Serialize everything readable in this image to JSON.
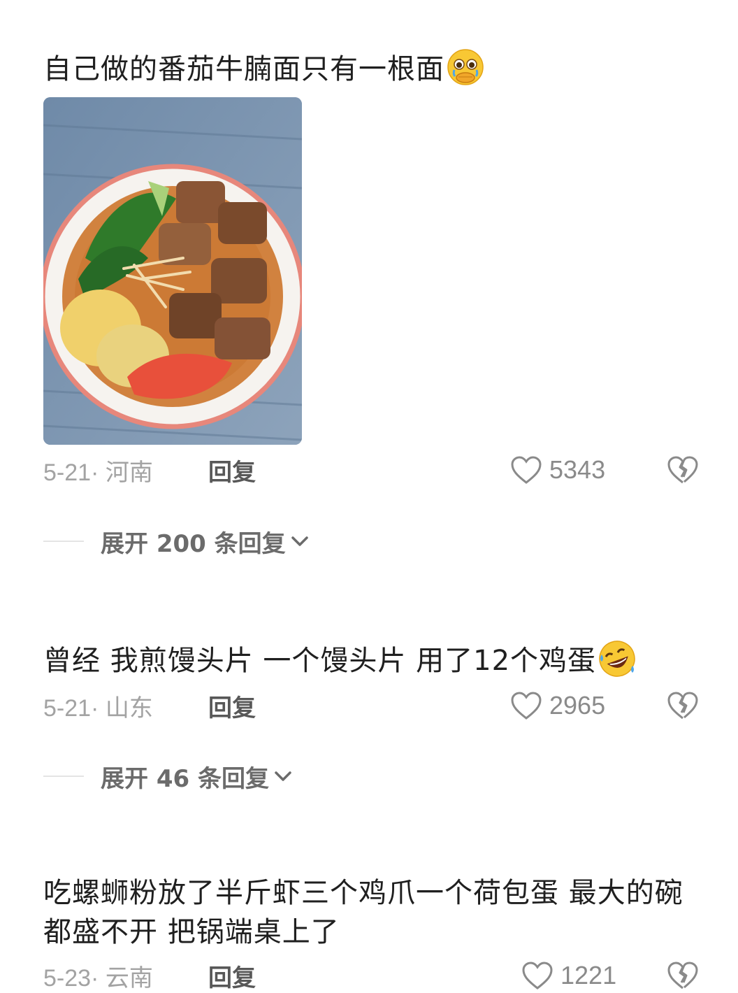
{
  "comments": [
    {
      "text": "自己做的番茄牛腩面只有一根面",
      "emoji": "crying-hands-over-mouth-emoji",
      "date_location": "5-21· 河南",
      "reply_label": "回复",
      "likes": "5343",
      "expand_label": "展开 200 条回复"
    },
    {
      "text": "曾经 我煎馒头片 一个馒头片 用了12个鸡蛋",
      "emoji": "rolling-on-floor-laughing-emoji",
      "date_location": "5-21· 山东",
      "reply_label": "回复",
      "likes": "2965",
      "expand_label": "展开 46 条回复"
    },
    {
      "text": "吃螺蛳粉放了半斤虾三个鸡爪一个荷包蛋 最大的碗都盛不开 把锅端桌上了",
      "date_location": "5-23· 云南",
      "reply_label": "回复",
      "likes": "1221"
    }
  ],
  "colors": {
    "text": "#1f1f1f",
    "meta": "#a3a3a3",
    "reply": "#585858",
    "icon": "#8a8a8a"
  }
}
